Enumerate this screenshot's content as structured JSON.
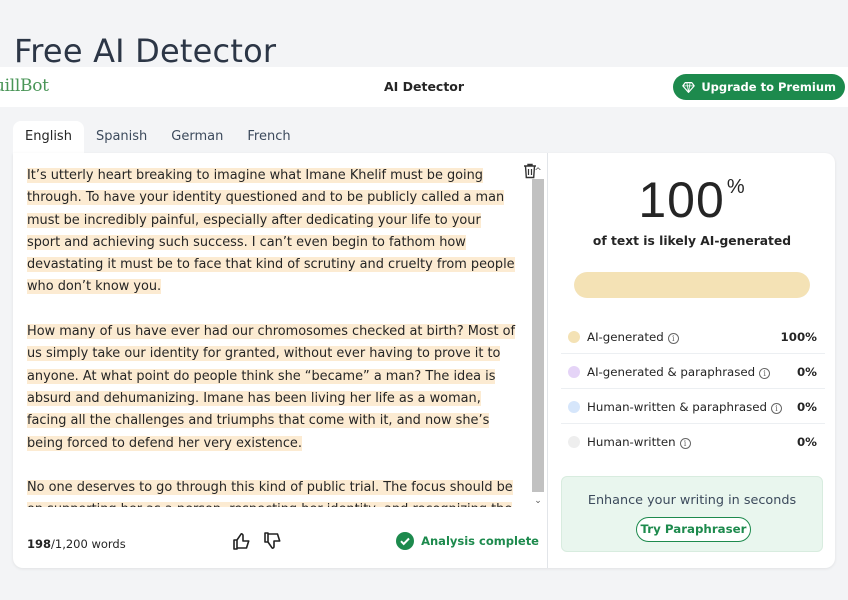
{
  "page": {
    "title": "Free AI Detector"
  },
  "topbar": {
    "logo_text": "uillBot",
    "title": "AI Detector",
    "upgrade_label": "Upgrade to Premium"
  },
  "tabs": [
    {
      "label": "English",
      "active": true
    },
    {
      "label": "Spanish",
      "active": false
    },
    {
      "label": "German",
      "active": false
    },
    {
      "label": "French",
      "active": false
    }
  ],
  "editor": {
    "paragraphs": [
      "It’s utterly heart breaking to imagine what Imane Khelif must be going through. To have your identity questioned and to be publicly called a man must be incredibly painful, especially after dedicating your life to your sport and achieving such success. I can’t even begin to fathom how devastating it must be to face that kind of scrutiny and cruelty from people who don’t know you.",
      "How many of us have ever had our chromosomes checked at birth? Most of us simply take our identity for granted, without ever having to prove it to anyone. At what point do people think she “became” a man? The idea is absurd and dehumanizing. Imane has been living her life as a woman, facing all the challenges and triumphs that come with it, and now she’s being forced to defend her very existence.",
      "No one deserves to go through this kind of public trial. The focus should be on supporting her as a person, respecting her identity, and recognizing the hard work she has put into her career."
    ],
    "word_count_current": "198",
    "word_count_limit": "/1,200 words",
    "status_text": "Analysis complete"
  },
  "results": {
    "score": "100",
    "score_unit": "%",
    "caption": "of text is likely AI-generated",
    "bar_fraction": 1.0,
    "legend": [
      {
        "label": "AI-generated",
        "value": "100%",
        "color": "#f4e2b5"
      },
      {
        "label": "AI-generated & paraphrased",
        "value": "0%",
        "color": "#e5d4f7"
      },
      {
        "label": "Human-written & paraphrased",
        "value": "0%",
        "color": "#d6e6fb"
      },
      {
        "label": "Human-written",
        "value": "0%",
        "color": "#eeeeee"
      }
    ],
    "enhance_text": "Enhance your writing in seconds",
    "paraphraser_label": "Try Paraphraser"
  },
  "colors": {
    "accent": "#1d8a4d",
    "highlight": "#fcebd2"
  }
}
